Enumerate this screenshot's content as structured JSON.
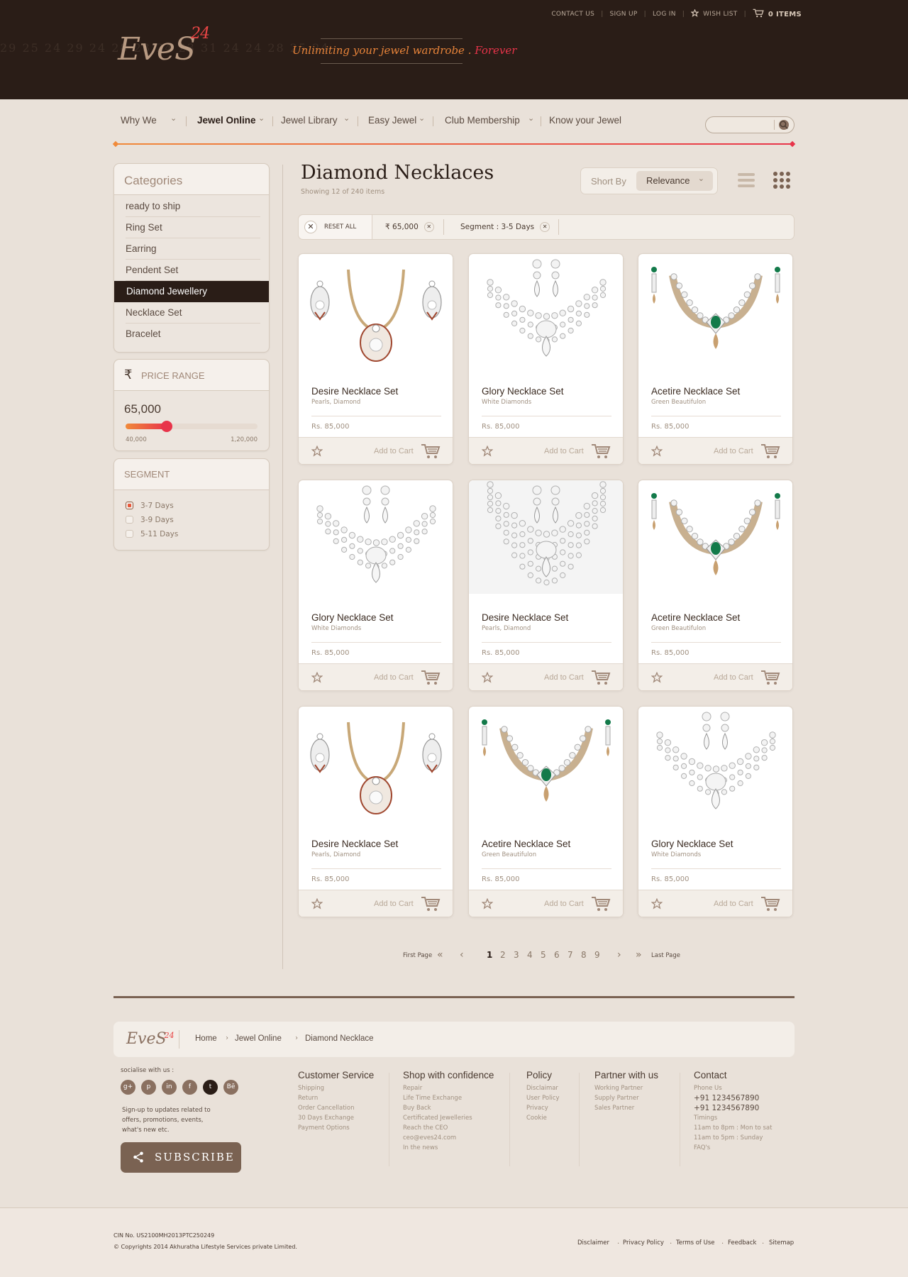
{
  "header": {
    "contact_us": "CONTACT US",
    "sign_up": "SIGN UP",
    "log_in": "LOG IN",
    "wish_list": "WISH LIST",
    "cart_items": "0 ITEMS",
    "logo_text": "EveS",
    "logo_num": "24",
    "tagline_main": "Unlimiting your jewel wardrobe . ",
    "tagline_end": "Forever",
    "bg_numbers": "29   25   24   29   24   28   23   24   23   31   24   24   28   25   24"
  },
  "nav": {
    "items": [
      {
        "label": "Why We"
      },
      {
        "label": "Jewel Online"
      },
      {
        "label": "Jewel Library"
      },
      {
        "label": "Easy Jewel"
      },
      {
        "label": "Club Membership"
      },
      {
        "label": "Know your Jewel"
      }
    ],
    "search_placeholder": ""
  },
  "sidebar": {
    "categories_title": "Categories",
    "categories": [
      {
        "label": "ready to ship"
      },
      {
        "label": "Ring Set"
      },
      {
        "label": "Earring"
      },
      {
        "label": "Pendent Set"
      },
      {
        "label": "Diamond Jewellery"
      },
      {
        "label": "Necklace Set"
      },
      {
        "label": "Bracelet"
      }
    ],
    "price_title": "PRICE RANGE",
    "price_value": "65,000",
    "price_min": "40,000",
    "price_max": "1,20,000",
    "price_fraction": 0.3125,
    "segment_title": "SEGMENT",
    "segments": [
      {
        "label": "3-7 Days",
        "checked": true
      },
      {
        "label": "3-9 Days",
        "checked": false
      },
      {
        "label": "5-11 Days",
        "checked": false
      }
    ]
  },
  "main": {
    "title": "Diamond Necklaces",
    "subtitle": "Showing 12 of 240 items",
    "sort_label": "Short By",
    "sort_value": "Relevance",
    "reset_all": "RESET ALL",
    "filter_price": "65,000",
    "filter_segment": "Segment : 3-5 Days",
    "add_to_cart": "Add to Cart",
    "products": [
      {
        "name": "Desire Necklace Set",
        "sub": "Pearls, Diamond",
        "price": "Rs. 85,000",
        "style": "desire"
      },
      {
        "name": "Glory Necklace Set",
        "sub": "White Diamonds",
        "price": "Rs. 85,000",
        "style": "glory"
      },
      {
        "name": "Acetire Necklace Set",
        "sub": "Green Beautifulon",
        "price": "Rs. 85,000",
        "style": "acetire"
      },
      {
        "name": "Glory Necklace Set",
        "sub": "White Diamonds",
        "price": "Rs. 85,000",
        "style": "glory"
      },
      {
        "name": "Desire Necklace Set",
        "sub": "Pearls, Diamond",
        "price": "Rs. 85,000",
        "style": "desire2"
      },
      {
        "name": "Acetire Necklace Set",
        "sub": "Green Beautifulon",
        "price": "Rs. 85,000",
        "style": "acetire"
      },
      {
        "name": "Desire Necklace Set",
        "sub": "Pearls, Diamond",
        "price": "Rs. 85,000",
        "style": "desire"
      },
      {
        "name": "Acetire Necklace Set",
        "sub": "Green Beautifulon",
        "price": "Rs. 85,000",
        "style": "acetire"
      },
      {
        "name": "Glory Necklace Set",
        "sub": "White Diamonds",
        "price": "Rs. 85,000",
        "style": "glory"
      }
    ]
  },
  "pagination": {
    "first": "First Page",
    "last": "Last Page",
    "pages": [
      "1",
      "2",
      "3",
      "4",
      "5",
      "6",
      "7",
      "8",
      "9"
    ],
    "current": "1"
  },
  "footer": {
    "logo_text": "EveS",
    "logo_num": "24",
    "breadcrumb": [
      "Home",
      "Jewel Online",
      "Diamond Necklace"
    ],
    "socialise": "socialise with us :",
    "social": [
      "g+",
      "p",
      "in",
      "f",
      "t",
      "Bē"
    ],
    "signup_text": "Sign-up to updates related to offers, promotions, events, what's new etc.",
    "subscribe": "SUBSCRIBE",
    "columns": [
      {
        "heading": "Customer Service",
        "links": [
          "Shipping",
          "Return",
          "Order Cancellation",
          "30 Days Exchange",
          "Payment Options"
        ]
      },
      {
        "heading": "Shop with confidence",
        "links": [
          "Repair",
          "Life Time Exchange",
          "Buy Back",
          "Certificated Jewelleries",
          "Reach the CEO",
          "ceo@eves24.com",
          "In the news"
        ]
      },
      {
        "heading": "Policy",
        "links": [
          "Disclaimar",
          "User Policy",
          "Privacy",
          "Cookie"
        ]
      },
      {
        "heading": "Partner with us",
        "links": [
          "Working Partner",
          "Supply Partner",
          "Sales Partner"
        ]
      },
      {
        "heading": "Contact",
        "links": [
          "Phone Us",
          "+91 1234567890",
          "+91 1234567890",
          "Timings",
          "11am to 8pm : Mon to sat",
          "11am to 5pm : Sunday",
          "FAQ's"
        ]
      }
    ],
    "cin": "CIN No. US2100MH2013PTC250249",
    "copyright": "©  Copyrights 2014 Akhuratha Lifestyle Services private Limited.",
    "bottom_links": [
      "Disclaimer",
      "Privacy Policy",
      "Terms of Use",
      "Feedback",
      "Sitemap"
    ]
  },
  "colors": {
    "header_bg": "#2a1d17",
    "accent_orange": "#f08a3a",
    "accent_red": "#e8344a",
    "page_bg": "#e9e1d9",
    "brown": "#7a6252"
  }
}
